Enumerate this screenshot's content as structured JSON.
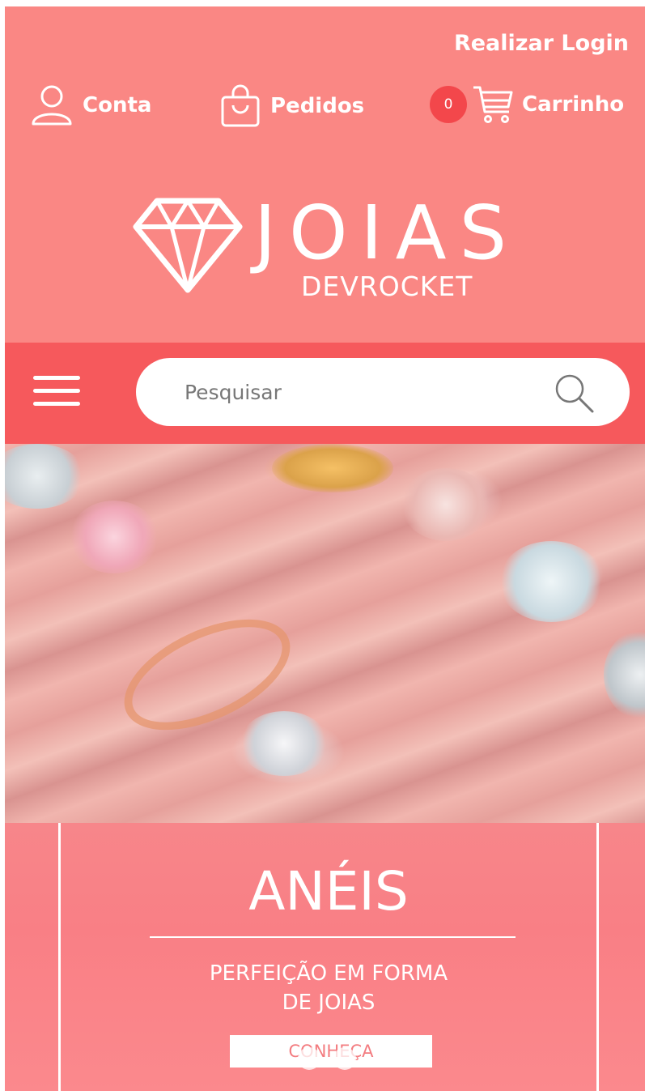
{
  "header": {
    "login_label": "Realizar Login",
    "nav": {
      "account_label": "Conta",
      "orders_label": "Pedidos",
      "cart_label": "Carrinho",
      "cart_count": "0"
    },
    "logo": {
      "main": "JOIAS",
      "sub": "DEVROCKET"
    }
  },
  "search": {
    "placeholder": "Pesquisar"
  },
  "banner": {
    "title": "ANÉIS",
    "subtitle_line1": "PERFEIÇÃO EM FORMA",
    "subtitle_line2": "DE JOIAS",
    "button_label": "CONHEÇA"
  },
  "colors": {
    "header_bg": "#fa8784",
    "search_bar_bg": "#f6595c",
    "badge_bg": "#f3474b"
  }
}
